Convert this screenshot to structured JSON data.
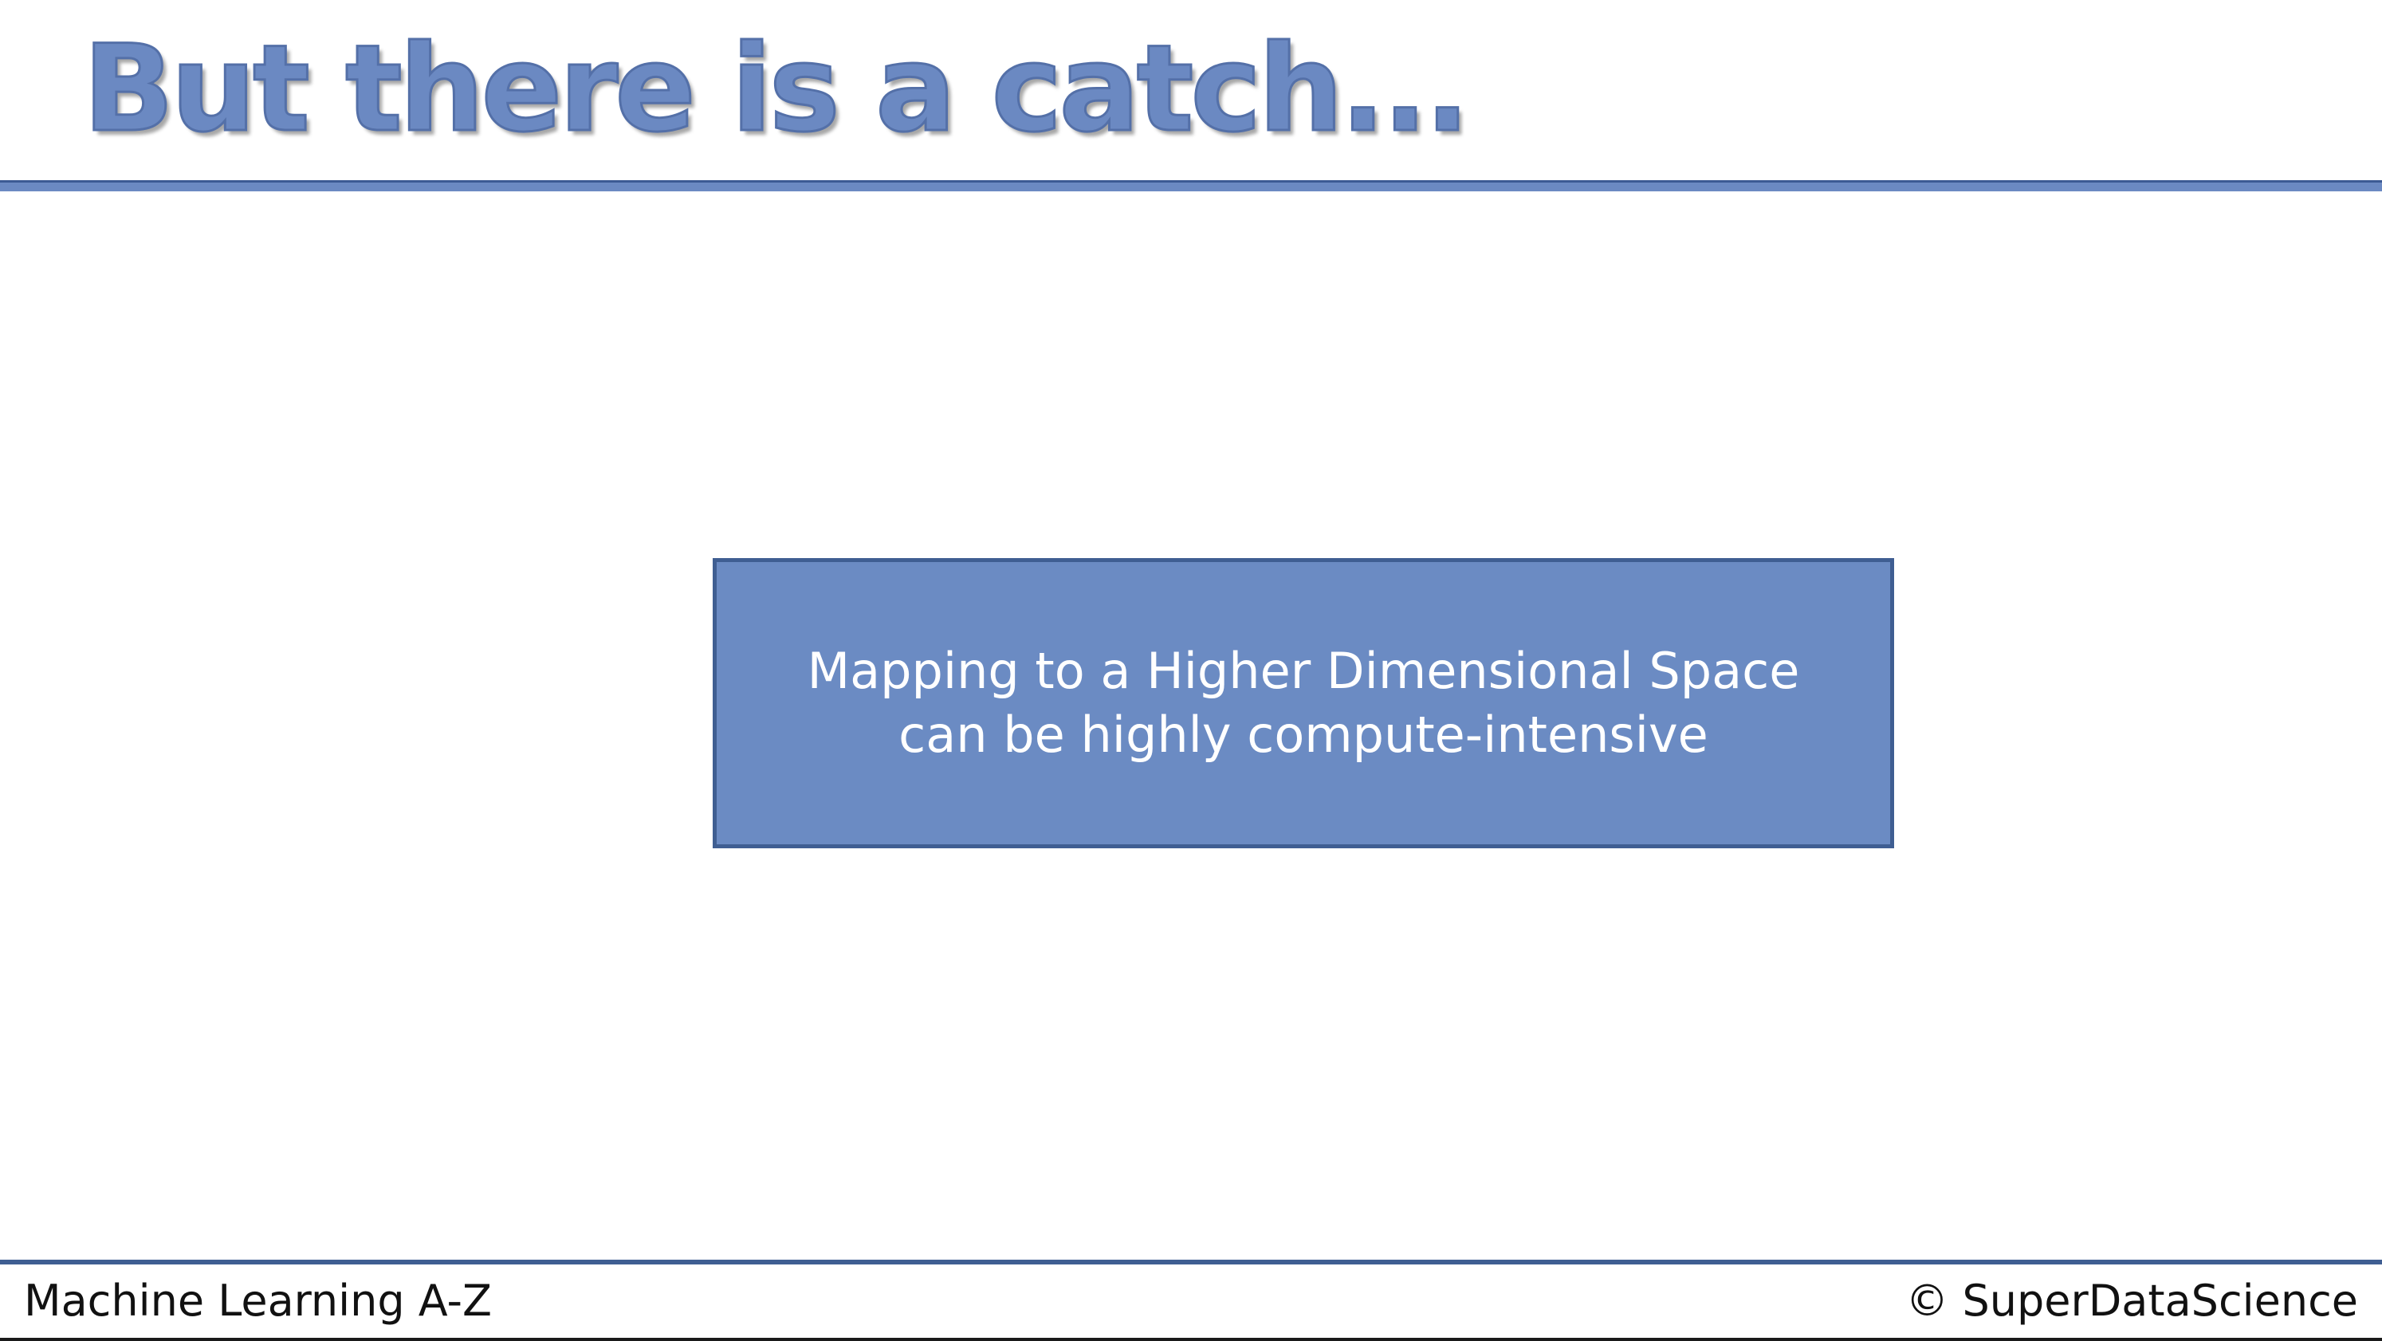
{
  "slide": {
    "title": "But there is a catch...",
    "callout": "Mapping to a Higher Dimensional Space\ncan be highly compute-intensive"
  },
  "footer": {
    "left": "Machine Learning A-Z",
    "right": "© SuperDataScience"
  },
  "colors": {
    "accent": "#6b89c2",
    "accent_dark": "#3f5e92",
    "background": "#ffffff"
  }
}
